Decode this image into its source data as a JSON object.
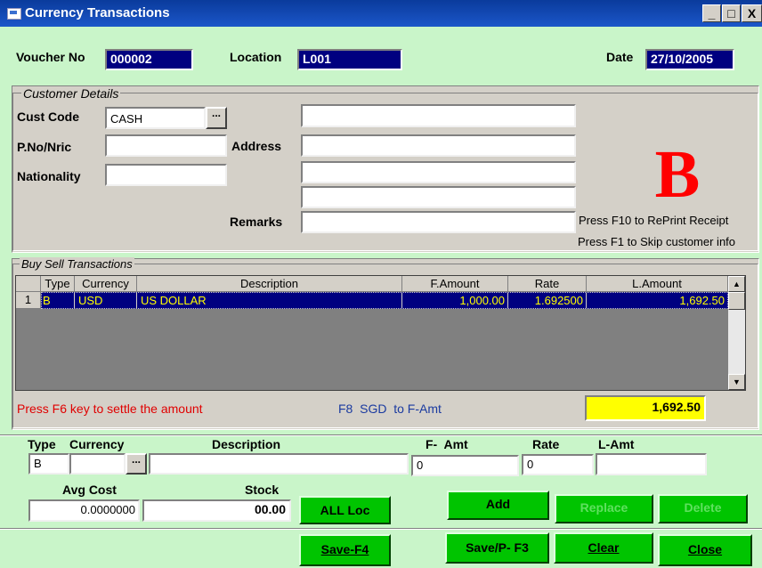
{
  "window": {
    "title": "Currency Transactions",
    "minimize": "_",
    "maximize": "□",
    "close": "X"
  },
  "header": {
    "voucher_label": "Voucher No",
    "voucher_value": "000002",
    "location_label": "Location",
    "location_value": "L001",
    "date_label": "Date",
    "date_value": "27/10/2005"
  },
  "customer": {
    "legend": "Customer Details",
    "cust_code_label": "Cust Code",
    "cust_code_value": "CASH",
    "pno_label": "P.No/Nric",
    "pno_value": "",
    "nationality_label": "Nationality",
    "nationality_value": "",
    "address_label": "Address",
    "name_value": "",
    "address1": "",
    "address2": "",
    "address3": "",
    "remarks_label": "Remarks",
    "remarks_value": "",
    "big_letter": "B",
    "hint_f10": "Press F10 to RePrint Receipt",
    "hint_f1": "Press F1 to Skip customer info",
    "lookup_button": "..."
  },
  "transactions": {
    "legend": "Buy Sell Transactions",
    "columns": [
      "",
      "Type",
      "Currency",
      "Description",
      "F.Amount",
      "Rate",
      "L.Amount"
    ],
    "rows": [
      {
        "no": "1",
        "type": "B",
        "currency": "USD",
        "description": "US DOLLAR",
        "famount": "1,000.00",
        "rate": "1.692500",
        "lamount": "1,692.50"
      }
    ],
    "settle_hint": "Press F6 key to settle the  amount",
    "f8_hint": "F8  SGD  to F-Amt",
    "total": "1,692.50"
  },
  "entry": {
    "type_label": "Type",
    "currency_label": "Currency",
    "description_label": "Description",
    "famt_label": "F-  Amt",
    "rate_label": "Rate",
    "lamt_label": "L-Amt",
    "type_value": "B",
    "currency_value": "",
    "description_value": "",
    "famt_value": "0",
    "rate_value": "0",
    "lamt_value": "",
    "avg_cost_label": "Avg Cost",
    "avg_cost_value": "0.0000000",
    "stock_label": "Stock",
    "stock_value": "00.00",
    "all_loc": "ALL Loc",
    "add": "Add",
    "replace": "Replace",
    "delete": "Delete"
  },
  "footer": {
    "save_f4": "Save-F4",
    "save_p_f3": "Save/P- F3",
    "clear": "Clear",
    "close": "Close"
  },
  "colors": {
    "background": "#c9f5c9",
    "title_bar": "#0a3b9c",
    "selected_row": "#000080",
    "button": "#00c400",
    "total_bg": "#ffff00",
    "big_letter": "#ff0000"
  }
}
